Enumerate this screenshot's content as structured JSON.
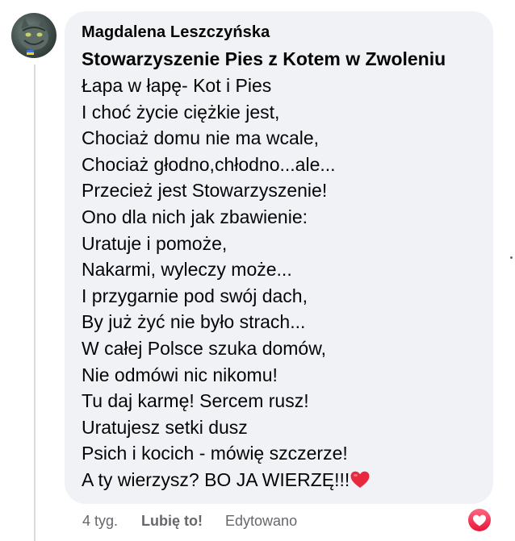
{
  "comment": {
    "author": "Magdalena Leszczyńska",
    "mention": "Stowarzyszenie Pies z Kotem w Zwoleniu",
    "lines": [
      "Łapa w łapę- Kot i Pies",
      "I choć życie ciężkie jest,",
      "Chociaż domu nie ma wcale,",
      "Chociaż głodno,chłodno...ale...",
      "Przecież jest Stowarzyszenie!",
      "Ono dla nich jak zbawienie:",
      "Uratuje i pomoże,",
      "Nakarmi, wyleczy może...",
      "I przygarnie pod swój dach,",
      "By już żyć nie było strach...",
      "W całej Polsce szuka domów,",
      "Nie odmówi nic nikomu!",
      "Tu daj karmę! Sercem rusz!",
      "Uratujesz setki dusz",
      "Psich i kocich - mówię szczerze!"
    ],
    "last_line": "A ty wierzysz? BO JA WIERZĘ!!!",
    "last_line_emoji": "red-heart-icon"
  },
  "actions": {
    "time": "4 tyg.",
    "like_label": "Lubię to!",
    "edited_label": "Edytowano"
  },
  "reaction": {
    "icon": "love-reaction-icon",
    "color": "#f33e58"
  },
  "colors": {
    "bubble": "#f0f2f5",
    "text": "#050505",
    "secondary": "#65676b"
  }
}
